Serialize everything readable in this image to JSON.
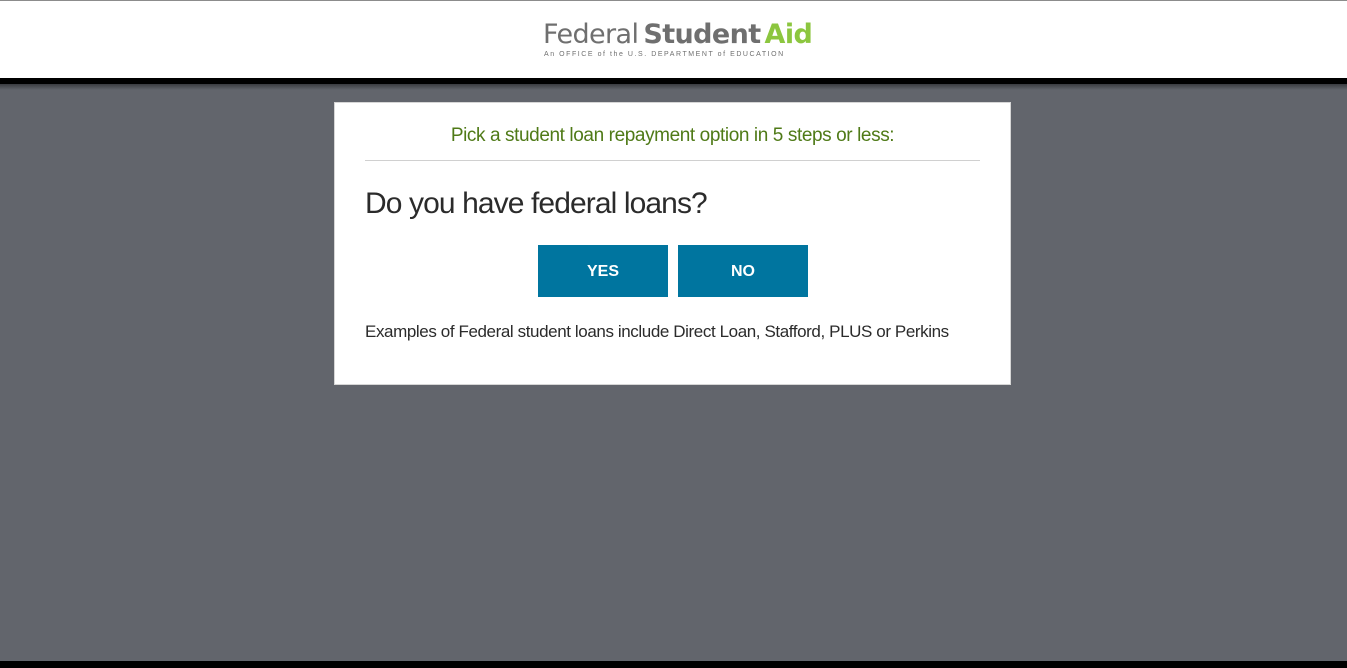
{
  "header": {
    "logo": {
      "word_federal": "Federal",
      "word_student": "Student",
      "word_aid": "Aid",
      "tagline": "An OFFICE of the U.S. DEPARTMENT of EDUCATION"
    }
  },
  "card": {
    "intro": "Pick a student loan repayment option in 5 steps or less:",
    "question": "Do you have federal loans?",
    "yes_label": "YES",
    "no_label": "NO",
    "examples": "Examples of Federal student loans include Direct Loan, Stafford, PLUS or Perkins"
  },
  "colors": {
    "button": "#00759f",
    "intro_text": "#4f7a17",
    "logo_accent": "#8cc63f",
    "backdrop": "#62656c"
  }
}
